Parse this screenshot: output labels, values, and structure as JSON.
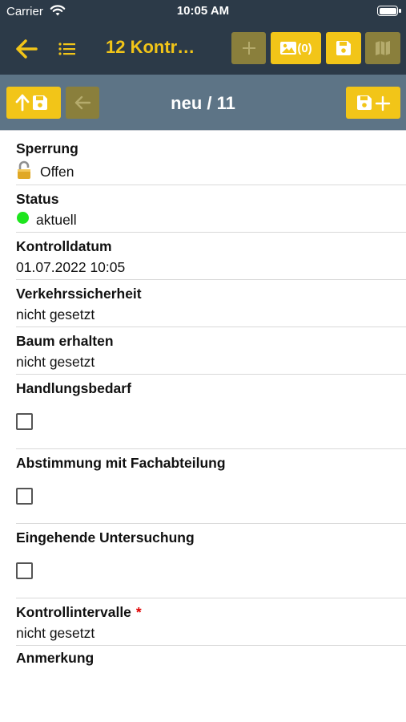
{
  "statusbar": {
    "carrier": "Carrier",
    "time": "10:05 AM"
  },
  "navbar": {
    "title": "12 Kontr…",
    "photo_count": "(0)"
  },
  "recordbar": {
    "counter": "neu / 11"
  },
  "fields": {
    "sperrung": {
      "label": "Sperrung",
      "value": "Offen"
    },
    "status": {
      "label": "Status",
      "value": "aktuell",
      "indicator_color": "#1ee51e"
    },
    "kontrolldatum": {
      "label": "Kontrolldatum",
      "value": "01.07.2022 10:05"
    },
    "verkehrssicherheit": {
      "label": "Verkehrssicherheit",
      "value": "nicht gesetzt"
    },
    "baum_erhalten": {
      "label": "Baum erhalten",
      "value": "nicht gesetzt"
    },
    "handlungsbedarf": {
      "label": "Handlungsbedarf",
      "checked": false
    },
    "abstimmung": {
      "label": "Abstimmung mit Fachabteilung",
      "checked": false
    },
    "untersuchung": {
      "label": "Eingehende Untersuchung",
      "checked": false
    },
    "kontrollintervalle": {
      "label": "Kontrollintervalle",
      "required_mark": "*",
      "value": "nicht gesetzt"
    },
    "anmerkung": {
      "label": "Anmerkung"
    }
  },
  "colors": {
    "header_bg": "#2c3a48",
    "recordbar_bg": "#5d7486",
    "accent": "#f2c518",
    "disabled": "#8a7f3c"
  },
  "icons": [
    "back-arrow-icon",
    "list-icon",
    "plus-icon",
    "photo-icon",
    "save-icon",
    "map-icon",
    "upload-save-icon",
    "prev-arrow-icon",
    "new-save-plus-icon",
    "lock-icon",
    "status-dot-icon",
    "wifi-icon",
    "battery-icon"
  ]
}
